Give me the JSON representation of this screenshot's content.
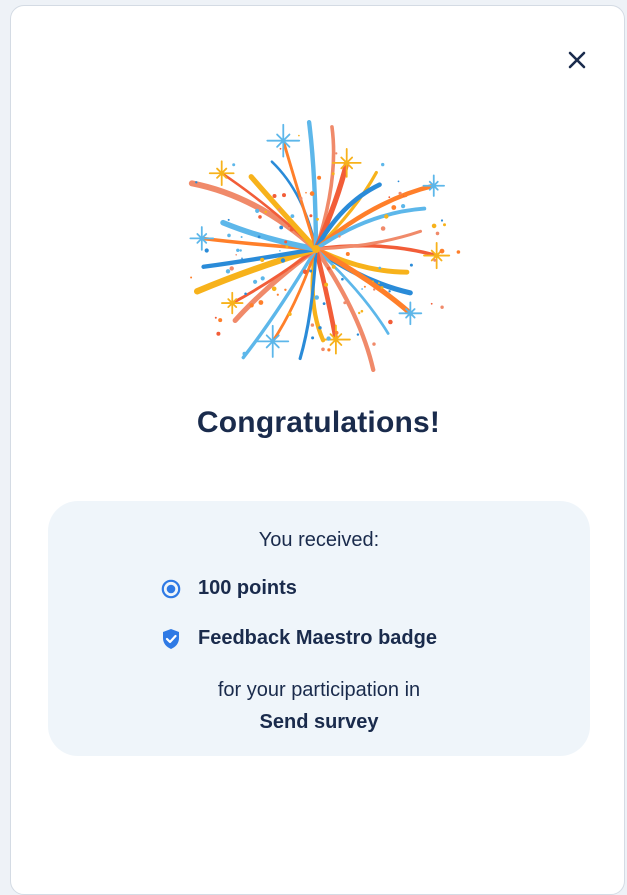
{
  "dialog": {
    "close_icon": "close-icon",
    "illustration": "fireworks-illustration",
    "title": "Congratulations!",
    "rewards": {
      "intro": "You received:",
      "items": [
        {
          "icon": "points-icon",
          "label": "100 points",
          "color": "#2f7ae5"
        },
        {
          "icon": "shield-check-icon",
          "label": "Feedback Maestro badge",
          "color": "#2f7ae5"
        }
      ],
      "participation_text": "for your participation in",
      "activity_name": "Send survey"
    }
  },
  "colors": {
    "text": "#1a2b4c",
    "accent": "#2f7ae5",
    "panel": "#eff5fa"
  }
}
